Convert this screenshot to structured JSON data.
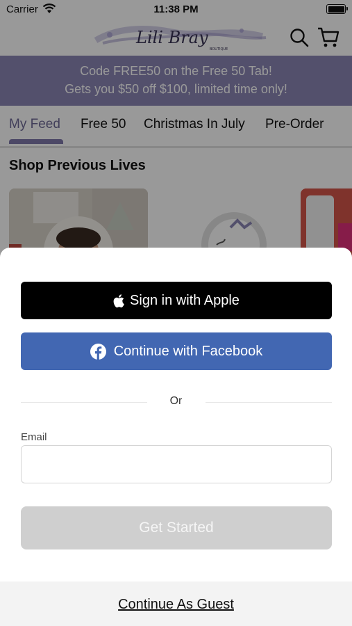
{
  "status_bar": {
    "carrier": "Carrier",
    "time": "11:38 PM"
  },
  "header": {
    "logo_text": "Lili Bray",
    "logo_subtext": "BOUTIQUE"
  },
  "promo": {
    "line1": "Code FREE50 on the Free 50 Tab!",
    "line2": "Gets you $50 off $100, limited time only!"
  },
  "tabs": [
    {
      "label": "My Feed",
      "active": true
    },
    {
      "label": "Free 50",
      "active": false
    },
    {
      "label": "Christmas In July",
      "active": false
    },
    {
      "label": "Pre-Order",
      "active": false
    }
  ],
  "section": {
    "title": "Shop Previous Lives"
  },
  "sheet": {
    "apple_label": "Sign in with Apple",
    "facebook_label": "Continue with Facebook",
    "divider_text": "Or",
    "email_label": "Email",
    "email_value": "",
    "get_started_label": "Get Started",
    "guest_label": "Continue As Guest"
  },
  "colors": {
    "promo_bg": "#8b86b5",
    "facebook_blue": "#4267b2",
    "disabled_button": "#cfcfcf"
  }
}
